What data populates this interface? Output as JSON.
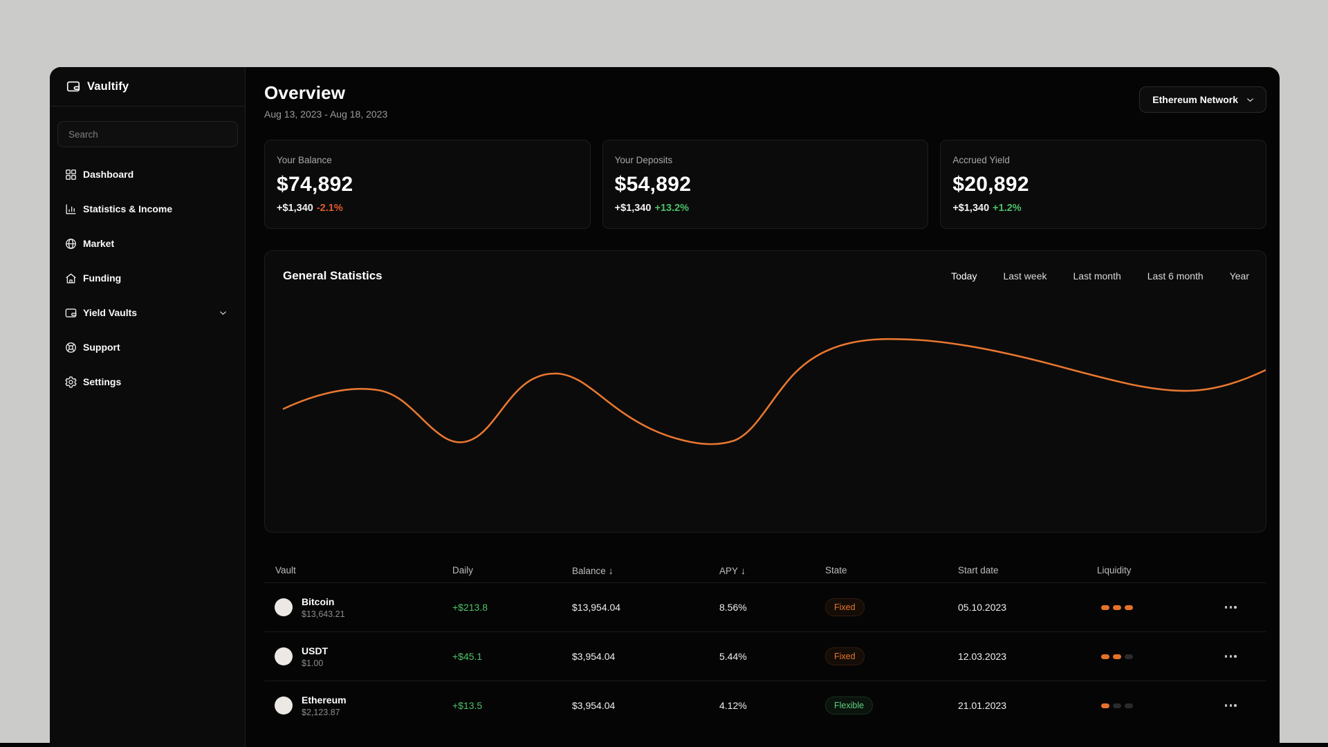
{
  "brand": {
    "name": "Vaultify"
  },
  "sidebar": {
    "search_placeholder": "Search",
    "items": [
      {
        "label": "Dashboard",
        "icon": "dashboard-icon"
      },
      {
        "label": "Statistics & Income",
        "icon": "bar-chart-icon"
      },
      {
        "label": "Market",
        "icon": "globe-icon"
      },
      {
        "label": "Funding",
        "icon": "home-icon"
      },
      {
        "label": "Yield Vaults",
        "icon": "wallet-icon",
        "expandable": true
      },
      {
        "label": "Support",
        "icon": "lifebuoy-icon"
      },
      {
        "label": "Settings",
        "icon": "gear-icon"
      }
    ]
  },
  "header": {
    "title": "Overview",
    "date_range": "Aug 13, 2023 - Aug 18, 2023",
    "network_selector": "Ethereum Network"
  },
  "stat_cards": [
    {
      "label": "Your Balance",
      "value": "$74,892",
      "delta": "+$1,340",
      "delta_pct": "-2.1%",
      "trend": "down"
    },
    {
      "label": "Your Deposits",
      "value": "$54,892",
      "delta": "+$1,340",
      "delta_pct": "+13.2%",
      "trend": "up"
    },
    {
      "label": "Accrued Yield",
      "value": "$20,892",
      "delta": "+$1,340",
      "delta_pct": "+1.2%",
      "trend": "up"
    }
  ],
  "chart": {
    "title": "General Statistics",
    "filters": [
      "Today",
      "Last week",
      "Last month",
      "Last 6 month",
      "Year"
    ],
    "active_filter": "Today",
    "line_color": "#e87730",
    "chart_data": {
      "type": "line",
      "title": "General Statistics",
      "x_fraction": [
        0,
        0.09,
        0.18,
        0.28,
        0.46,
        0.58,
        0.68,
        0.93,
        1.0
      ],
      "values": [
        33,
        51,
        0,
        67,
        0,
        100,
        100,
        50,
        70
      ],
      "xlabel": "",
      "ylabel": "",
      "grid": false,
      "legend": false,
      "axis_labels_visible": false
    }
  },
  "table": {
    "columns": [
      {
        "label": "Vault"
      },
      {
        "label": "Daily"
      },
      {
        "label": "Balance",
        "sort_icon": "↓"
      },
      {
        "label": "APY",
        "sort_icon": "↓"
      },
      {
        "label": "State"
      },
      {
        "label": "Start date"
      },
      {
        "label": "Liquidity"
      }
    ],
    "rows": [
      {
        "vault": "Bitcoin",
        "price": "$13,643.21",
        "daily": "+$213.8",
        "balance": "$13,954.04",
        "apy": "8.56%",
        "state": "Fixed",
        "state_type": "fixed",
        "start_date": "05.10.2023",
        "liquidity": 3
      },
      {
        "vault": "USDT",
        "price": "$1.00",
        "daily": "+$45.1",
        "balance": "$3,954.04",
        "apy": "5.44%",
        "state": "Fixed",
        "state_type": "fixed",
        "start_date": "12.03.2023",
        "liquidity": 2
      },
      {
        "vault": "Ethereum",
        "price": "$2,123.87",
        "daily": "+$13.5",
        "balance": "$3,954.04",
        "apy": "4.12%",
        "state": "Flexible",
        "state_type": "flexible",
        "start_date": "21.01.2023",
        "liquidity": 1
      }
    ]
  },
  "colors": {
    "accent_orange": "#e87730",
    "positive_green": "#4cc168",
    "negative_orange": "#e05c2e"
  }
}
